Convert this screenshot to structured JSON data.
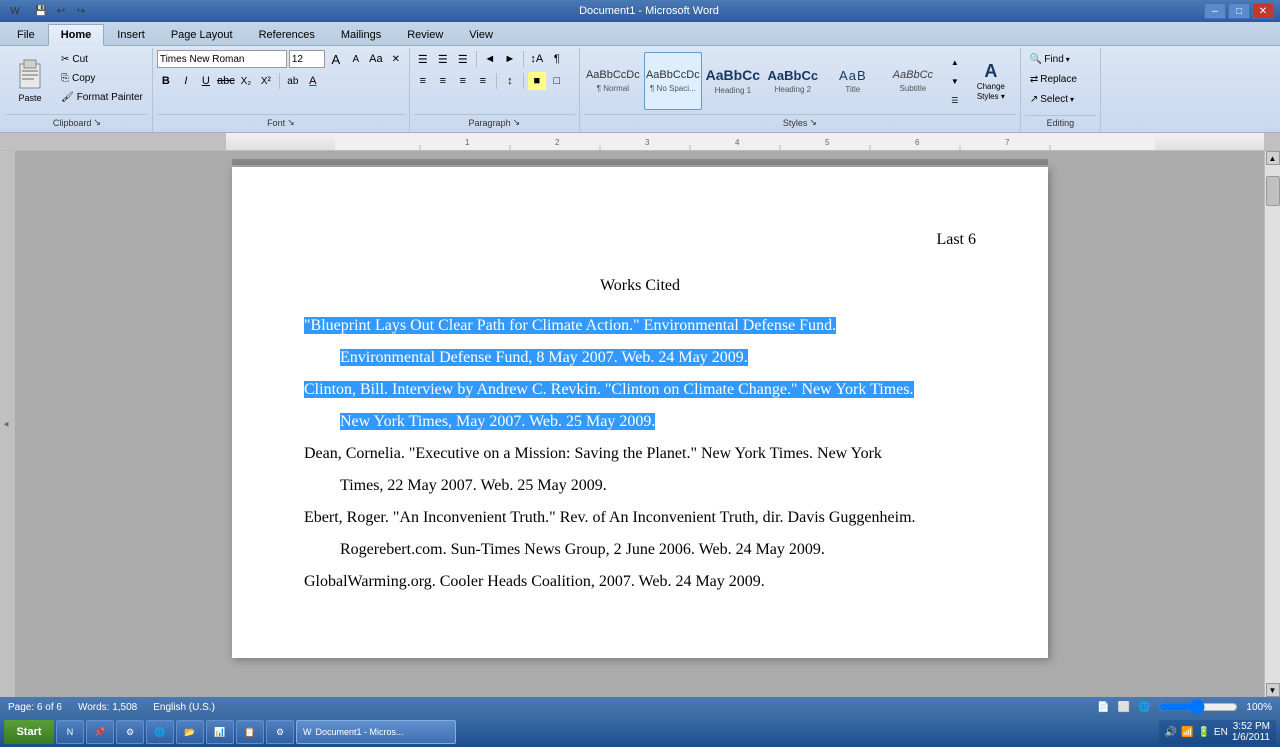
{
  "titlebar": {
    "title": "Document1 - Microsoft Word",
    "min_btn": "–",
    "max_btn": "□",
    "close_btn": "✕",
    "quick_access": [
      "💾",
      "↩",
      "↪"
    ]
  },
  "tabs": [
    {
      "label": "File",
      "active": false
    },
    {
      "label": "Home",
      "active": true
    },
    {
      "label": "Insert",
      "active": false
    },
    {
      "label": "Page Layout",
      "active": false
    },
    {
      "label": "References",
      "active": false
    },
    {
      "label": "Mailings",
      "active": false
    },
    {
      "label": "Review",
      "active": false
    },
    {
      "label": "View",
      "active": false
    }
  ],
  "ribbon": {
    "clipboard": {
      "label": "Clipboard",
      "paste": "Paste",
      "cut": "Cut",
      "copy": "Copy",
      "format_painter": "Format Painter"
    },
    "font": {
      "label": "Font",
      "font_name": "Times New Roman",
      "font_size": "12",
      "bold": "B",
      "italic": "I",
      "underline": "U",
      "strikethrough": "abc",
      "subscript": "X₂",
      "superscript": "X²",
      "font_color": "A",
      "highlight": "ab",
      "grow": "A",
      "shrink": "A",
      "change_case": "Aa",
      "clear": "✕"
    },
    "paragraph": {
      "label": "Paragraph",
      "bullets": "☰",
      "numbering": "☰",
      "multilevel": "☰",
      "decrease_indent": "◄",
      "increase_indent": "►",
      "sort": "↕",
      "show_hide": "¶",
      "align_left": "≡",
      "align_center": "≡",
      "align_right": "≡",
      "justify": "≡",
      "line_spacing": "≡",
      "shading": "■",
      "borders": "□"
    },
    "styles": {
      "label": "Styles",
      "items": [
        {
          "name": "Normal",
          "preview_class": "normal-preview",
          "preview": "AaBbCcDc"
        },
        {
          "name": "¶ No Spaci...",
          "preview_class": "normal-preview",
          "preview": "AaBbCcDc",
          "selected": true
        },
        {
          "name": "Heading 1",
          "preview_class": "h1-preview",
          "preview": "AaBbCc"
        },
        {
          "name": "Heading 2",
          "preview_class": "h2-preview",
          "preview": "AaBbCc"
        },
        {
          "name": "Title",
          "preview_class": "title-preview",
          "preview": "AaB"
        },
        {
          "name": "Subtitle",
          "preview_class": "subtitle-preview",
          "preview": "AaBbCc"
        }
      ],
      "change_styles": "Change Styles ▾"
    },
    "editing": {
      "label": "Editing",
      "find": "Find",
      "replace": "Replace",
      "select": "Select"
    }
  },
  "document": {
    "header_right": "Last 6",
    "title": "Works Cited",
    "entries": [
      {
        "id": 1,
        "text": "\"Blueprint Lays Out Clear Path for Climate Action.\" Environmental Defense Fund. Environmental Defense Fund, 8 May 2007. Web. 24 May 2009.",
        "selected": true
      },
      {
        "id": 2,
        "text": "Clinton, Bill. Interview by Andrew C. Revkin. \"Clinton on Climate Change.\" New York Times. New York Times, May 2007. Web. 25 May 2009.",
        "selected": true
      },
      {
        "id": 3,
        "text": "Dean, Cornelia. \"Executive on a Mission: Saving the Planet.\" New York Times. New York Times, 22 May 2007. Web. 25 May 2009.",
        "selected": false
      },
      {
        "id": 4,
        "text": "Ebert, Roger. \"An Inconvenient Truth.\" Rev. of An Inconvenient Truth, dir. Davis Guggenheim. Rogerebert.com. Sun-Times News Group, 2 June 2006. Web. 24 May 2009.",
        "selected": false
      },
      {
        "id": 5,
        "text": "GlobalWarming.org. Cooler Heads Coalition, 2007. Web. 24 May 2009.",
        "selected": false
      }
    ]
  },
  "statusbar": {
    "page": "Page: 6 of 6",
    "words": "Words: 1,508",
    "language": "English (U.S.)",
    "zoom": "100%",
    "time": "3:52 PM",
    "date": "1/6/2011"
  },
  "taskbar": {
    "start_label": "Start",
    "active_window": "Document1 - Micros...",
    "tray_time": "3:52 PM",
    "tray_date": "1/6/2011"
  }
}
